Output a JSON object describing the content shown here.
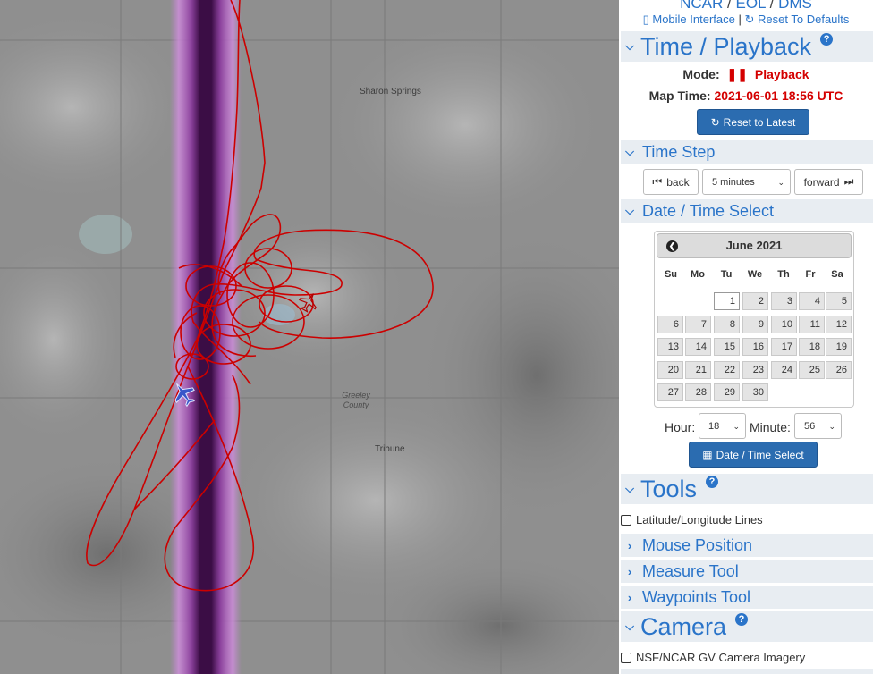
{
  "map": {
    "towns": [
      "Sharon Springs",
      "Tribune"
    ],
    "county": [
      "Greeley",
      "County"
    ]
  },
  "breadcrumb": {
    "items": [
      "NCAR",
      "EOL",
      "DMS"
    ],
    "separator": "/"
  },
  "links": {
    "mobile": "Mobile Interface",
    "divider": "|",
    "reset": "Reset To Defaults"
  },
  "sections": {
    "time_playback": "Time / Playback",
    "time_step": "Time Step",
    "date_time_select": "Date / Time Select",
    "tools": "Tools",
    "mouse_position": "Mouse Position",
    "measure_tool": "Measure Tool",
    "waypoints_tool": "Waypoints Tool",
    "camera": "Camera"
  },
  "playback": {
    "mode_label": "Mode:",
    "mode_value": "Playback",
    "map_time_label": "Map Time:",
    "map_time_value": "2021-06-01 18:56 UTC",
    "reset_button": "Reset to Latest"
  },
  "time_step": {
    "back": "back",
    "step": "5 minutes",
    "forward": "forward"
  },
  "calendar": {
    "title": "June 2021",
    "days_of_week": [
      "Su",
      "Mo",
      "Tu",
      "We",
      "Th",
      "Fr",
      "Sa"
    ],
    "days": [
      "1",
      "2",
      "3",
      "4",
      "5",
      "6",
      "7",
      "8",
      "9",
      "10",
      "11",
      "12",
      "13",
      "14",
      "15",
      "16",
      "17",
      "18",
      "19",
      "20",
      "21",
      "22",
      "23",
      "24",
      "25",
      "26",
      "27",
      "28",
      "29",
      "30"
    ],
    "selected_day": "1",
    "hour_label": "Hour:",
    "hour_value": "18",
    "minute_label": "Minute:",
    "minute_value": "56",
    "submit": "Date / Time Select"
  },
  "tools": {
    "lat_lon": "Latitude/Longitude Lines"
  },
  "camera": {
    "imagery": "NSF/NCAR GV Camera Imagery"
  },
  "colors": {
    "track": "#cc0000",
    "link": "#2a74c9",
    "accent_red": "#d40000",
    "button_blue": "#2b6cb0"
  }
}
